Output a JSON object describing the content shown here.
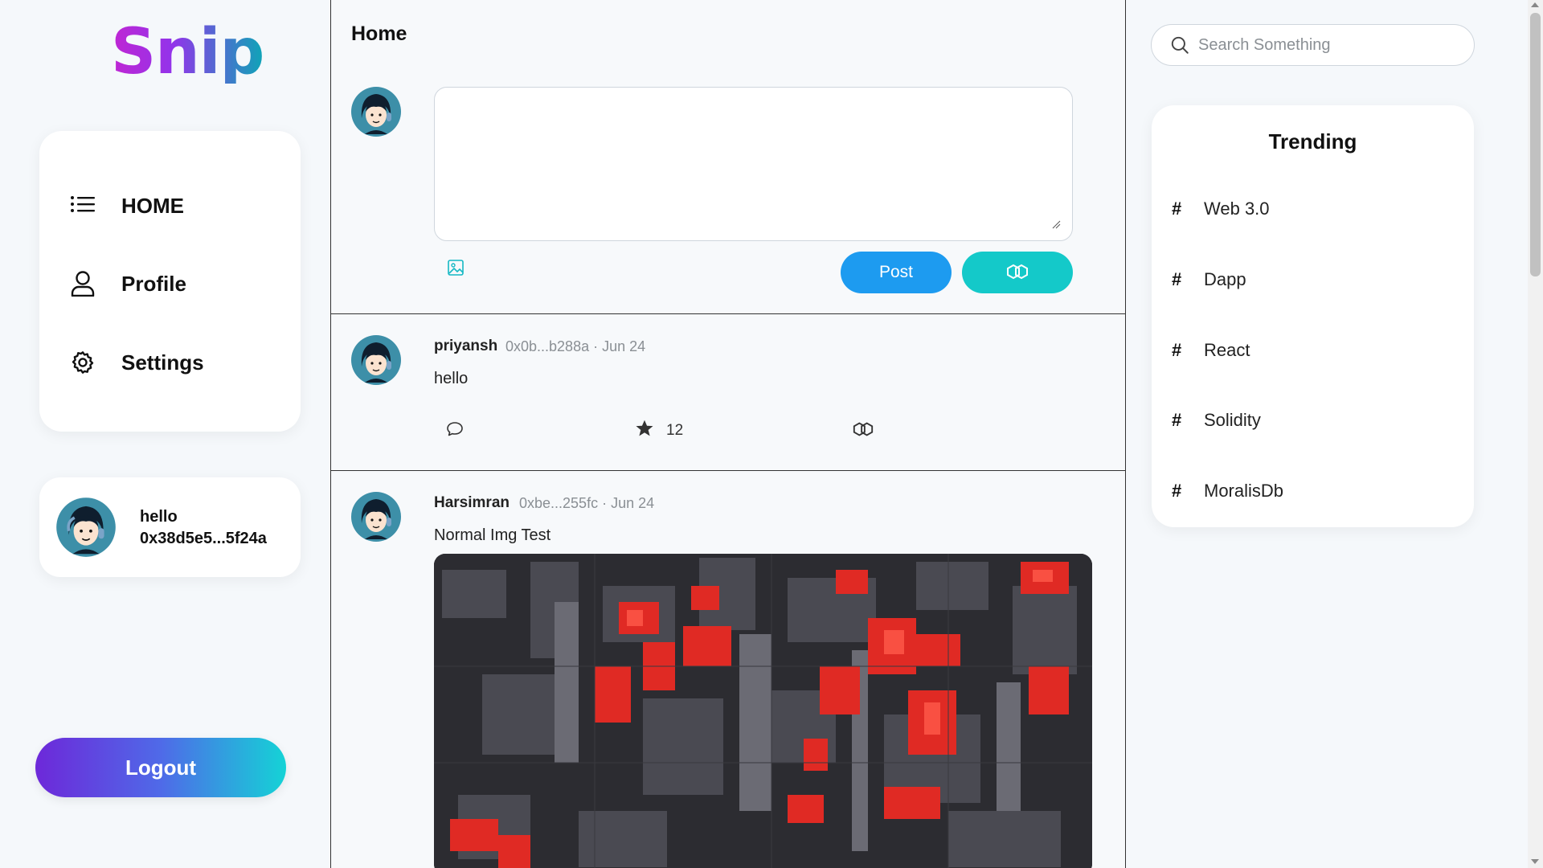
{
  "brand": {
    "logo_text": "Snip"
  },
  "nav": {
    "items": [
      {
        "label": "HOME",
        "icon": "list-icon"
      },
      {
        "label": "Profile",
        "icon": "user-icon"
      },
      {
        "label": "Settings",
        "icon": "gear-icon"
      }
    ]
  },
  "current_user": {
    "name": "hello",
    "address": "0x38d5e5...5f24a"
  },
  "logout_label": "Logout",
  "main": {
    "title": "Home",
    "composer": {
      "value": "",
      "placeholder": "",
      "post_label": "Post",
      "image_icon": "image-icon",
      "mint_icon": "link-icon"
    }
  },
  "posts": [
    {
      "author": "priyansh",
      "meta": "0x0b...b288a · Jun 24",
      "text": "hello",
      "star_count": "12"
    },
    {
      "author": "Harsimran",
      "meta": "0xbe...255fc · Jun 24",
      "text": "Normal Img Test"
    }
  ],
  "search": {
    "placeholder": "Search Something"
  },
  "trending": {
    "title": "Trending",
    "items": [
      "Web 3.0",
      "Dapp",
      "React",
      "Solidity",
      "MoralisDb"
    ],
    "hash": "#"
  },
  "colors": {
    "post_button": "#1d9bf0",
    "mint_button": "#14c9c9",
    "logo_gradient_start": "#c026d3",
    "logo_gradient_end": "#0ea5b7"
  }
}
